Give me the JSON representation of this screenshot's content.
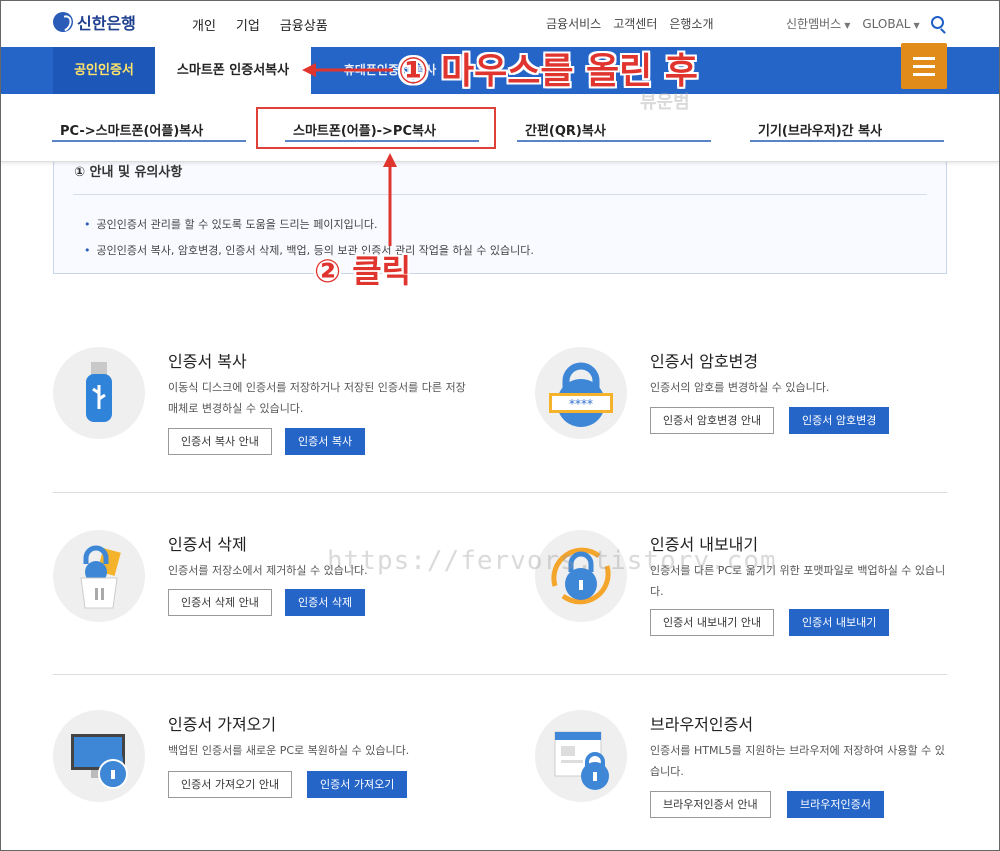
{
  "logo": {
    "text": "신한은행"
  },
  "main_nav": [
    "개인",
    "기업",
    "금융상품"
  ],
  "util_nav": [
    "금융서비스",
    "고객센터",
    "은행소개"
  ],
  "right_nav": {
    "membership": "신한멤버스",
    "global": "GLOBAL"
  },
  "tabs": {
    "cert": "공인인증서",
    "smart": "스마트폰 인증서복사",
    "hidden": "휴대폰인증서 복사"
  },
  "submenu": [
    "PC->스마트폰(어플)복사",
    "스마트폰(어플)->PC복사",
    "간편(QR)복사",
    "기기(브라우저)간 복사"
  ],
  "annotations": {
    "step1": "① 마우스를 올린 후",
    "step2": "② 클릭",
    "watermark_top": "뷰운범",
    "watermark_url": "https://fervors.tistory.com"
  },
  "info": {
    "heading": "① 안내 및 유의사항",
    "bullets": [
      "공인인증서 관리를 할 수 있도록 도움을 드리는 페이지입니다.",
      "공인인증서 복사, 암호변경, 인증서 삭제, 백업, 등의 보관 인증서 관리 작업을 하실 수 있습니다."
    ]
  },
  "services": [
    {
      "title": "인증서 복사",
      "desc": "이동식 디스크에 인증서를 저장하거나 저장된 인증서를 다른 저장매체로 변경하실 수 있습니다.",
      "guide": "인증서 복사 안내",
      "action": "인증서 복사",
      "icon": "usb-icon"
    },
    {
      "title": "인증서 암호변경",
      "desc": "인증서의 암호를 변경하실 수 있습니다.",
      "guide": "인증서 암호변경 안내",
      "action": "인증서 암호변경",
      "icon": "password-lock-icon"
    },
    {
      "title": "인증서 삭제",
      "desc": "인증서를 저장소에서 제거하실 수 있습니다.",
      "guide": "인증서 삭제 안내",
      "action": "인증서 삭제",
      "icon": "trash-icon"
    },
    {
      "title": "인증서 내보내기",
      "desc": "인증서를 다른 PC로 옮기기 위한 포맷파일로 백업하실 수 있습니다.",
      "guide": "인증서 내보내기 안내",
      "action": "인증서 내보내기",
      "icon": "export-lock-icon"
    },
    {
      "title": "인증서 가져오기",
      "desc": "백업된 인증서를 새로운 PC로 복원하실 수 있습니다.",
      "guide": "인증서 가져오기 안내",
      "action": "인증서 가져오기",
      "icon": "monitor-lock-icon"
    },
    {
      "title": "브라우저인증서",
      "desc": "인증서를 HTML5를 지원하는 브라우저에 저장하여 사용할 수 있습니다.",
      "guide": "브라우저인증서 안내",
      "action": "브라우저인증서",
      "icon": "browser-lock-icon"
    }
  ],
  "colors": {
    "primary": "#2565c8",
    "accent": "#e08b1a",
    "annotation": "#e0342f",
    "active_tab_text": "#ffe36a"
  }
}
